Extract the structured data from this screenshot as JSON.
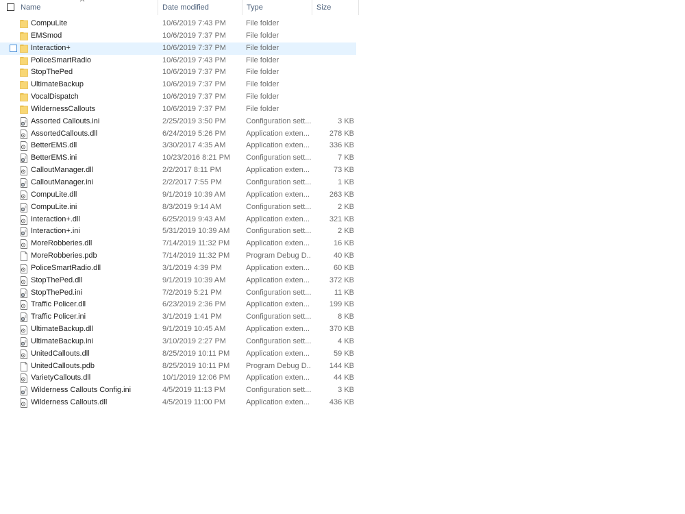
{
  "columns": {
    "name": "Name",
    "date": "Date modified",
    "type": "Type",
    "size": "Size"
  },
  "sort": {
    "column": "name",
    "direction": "ascending",
    "icon": "chevron-up-icon"
  },
  "colors": {
    "selection": "#e5f3ff",
    "folder": "#f8d775",
    "header_text": "#4c607a",
    "muted_text": "#6d6d6d"
  },
  "files": [
    {
      "name": "CompuLite",
      "date": "10/6/2019 7:43 PM",
      "type": "File folder",
      "size": "",
      "icon": "folder-icon"
    },
    {
      "name": "EMSmod",
      "date": "10/6/2019 7:37 PM",
      "type": "File folder",
      "size": "",
      "icon": "folder-icon"
    },
    {
      "name": "Interaction+",
      "date": "10/6/2019 7:37 PM",
      "type": "File folder",
      "size": "",
      "icon": "folder-icon",
      "selected": true
    },
    {
      "name": "PoliceSmartRadio",
      "date": "10/6/2019 7:43 PM",
      "type": "File folder",
      "size": "",
      "icon": "folder-icon"
    },
    {
      "name": "StopThePed",
      "date": "10/6/2019 7:37 PM",
      "type": "File folder",
      "size": "",
      "icon": "folder-icon"
    },
    {
      "name": "UltimateBackup",
      "date": "10/6/2019 7:37 PM",
      "type": "File folder",
      "size": "",
      "icon": "folder-icon"
    },
    {
      "name": "VocalDispatch",
      "date": "10/6/2019 7:37 PM",
      "type": "File folder",
      "size": "",
      "icon": "folder-icon"
    },
    {
      "name": "WildernessCallouts",
      "date": "10/6/2019 7:37 PM",
      "type": "File folder",
      "size": "",
      "icon": "folder-icon"
    },
    {
      "name": "Assorted Callouts.ini",
      "date": "2/25/2019 3:50 PM",
      "type": "Configuration sett...",
      "size": "3 KB",
      "icon": "config-file-icon"
    },
    {
      "name": "AssortedCallouts.dll",
      "date": "6/24/2019 5:26 PM",
      "type": "Application exten...",
      "size": "278 KB",
      "icon": "dll-file-icon"
    },
    {
      "name": "BetterEMS.dll",
      "date": "3/30/2017 4:35 AM",
      "type": "Application exten...",
      "size": "336 KB",
      "icon": "dll-file-icon"
    },
    {
      "name": "BetterEMS.ini",
      "date": "10/23/2016 8:21 PM",
      "type": "Configuration sett...",
      "size": "7 KB",
      "icon": "config-file-icon"
    },
    {
      "name": "CalloutManager.dll",
      "date": "2/2/2017 8:11 PM",
      "type": "Application exten...",
      "size": "73 KB",
      "icon": "dll-file-icon"
    },
    {
      "name": "CalloutManager.ini",
      "date": "2/2/2017 7:55 PM",
      "type": "Configuration sett...",
      "size": "1 KB",
      "icon": "config-file-icon"
    },
    {
      "name": "CompuLite.dll",
      "date": "9/1/2019 10:39 AM",
      "type": "Application exten...",
      "size": "263 KB",
      "icon": "dll-file-icon"
    },
    {
      "name": "CompuLite.ini",
      "date": "8/3/2019 9:14 AM",
      "type": "Configuration sett...",
      "size": "2 KB",
      "icon": "config-file-icon"
    },
    {
      "name": "Interaction+.dll",
      "date": "6/25/2019 9:43 AM",
      "type": "Application exten...",
      "size": "321 KB",
      "icon": "dll-file-icon"
    },
    {
      "name": "Interaction+.ini",
      "date": "5/31/2019 10:39 AM",
      "type": "Configuration sett...",
      "size": "2 KB",
      "icon": "config-file-icon"
    },
    {
      "name": "MoreRobberies.dll",
      "date": "7/14/2019 11:32 PM",
      "type": "Application exten...",
      "size": "16 KB",
      "icon": "dll-file-icon"
    },
    {
      "name": "MoreRobberies.pdb",
      "date": "7/14/2019 11:32 PM",
      "type": "Program Debug D...",
      "size": "40 KB",
      "icon": "blank-file-icon"
    },
    {
      "name": "PoliceSmartRadio.dll",
      "date": "3/1/2019 4:39 PM",
      "type": "Application exten...",
      "size": "60 KB",
      "icon": "dll-file-icon"
    },
    {
      "name": "StopThePed.dll",
      "date": "9/1/2019 10:39 AM",
      "type": "Application exten...",
      "size": "372 KB",
      "icon": "dll-file-icon"
    },
    {
      "name": "StopThePed.ini",
      "date": "7/2/2019 5:21 PM",
      "type": "Configuration sett...",
      "size": "11 KB",
      "icon": "config-file-icon"
    },
    {
      "name": "Traffic Policer.dll",
      "date": "6/23/2019 2:36 PM",
      "type": "Application exten...",
      "size": "199 KB",
      "icon": "dll-file-icon"
    },
    {
      "name": "Traffic Policer.ini",
      "date": "3/1/2019 1:41 PM",
      "type": "Configuration sett...",
      "size": "8 KB",
      "icon": "config-file-icon"
    },
    {
      "name": "UltimateBackup.dll",
      "date": "9/1/2019 10:45 AM",
      "type": "Application exten...",
      "size": "370 KB",
      "icon": "dll-file-icon"
    },
    {
      "name": "UltimateBackup.ini",
      "date": "3/10/2019 2:27 PM",
      "type": "Configuration sett...",
      "size": "4 KB",
      "icon": "config-file-icon"
    },
    {
      "name": "UnitedCallouts.dll",
      "date": "8/25/2019 10:11 PM",
      "type": "Application exten...",
      "size": "59 KB",
      "icon": "dll-file-icon"
    },
    {
      "name": "UnitedCallouts.pdb",
      "date": "8/25/2019 10:11 PM",
      "type": "Program Debug D...",
      "size": "144 KB",
      "icon": "blank-file-icon"
    },
    {
      "name": "VarietyCallouts.dll",
      "date": "10/1/2019 12:06 PM",
      "type": "Application exten...",
      "size": "44 KB",
      "icon": "dll-file-icon"
    },
    {
      "name": "Wilderness Callouts Config.ini",
      "date": "4/5/2019 11:13 PM",
      "type": "Configuration sett...",
      "size": "3 KB",
      "icon": "config-file-icon"
    },
    {
      "name": "Wilderness Callouts.dll",
      "date": "4/5/2019 11:00 PM",
      "type": "Application exten...",
      "size": "436 KB",
      "icon": "dll-file-icon"
    }
  ]
}
